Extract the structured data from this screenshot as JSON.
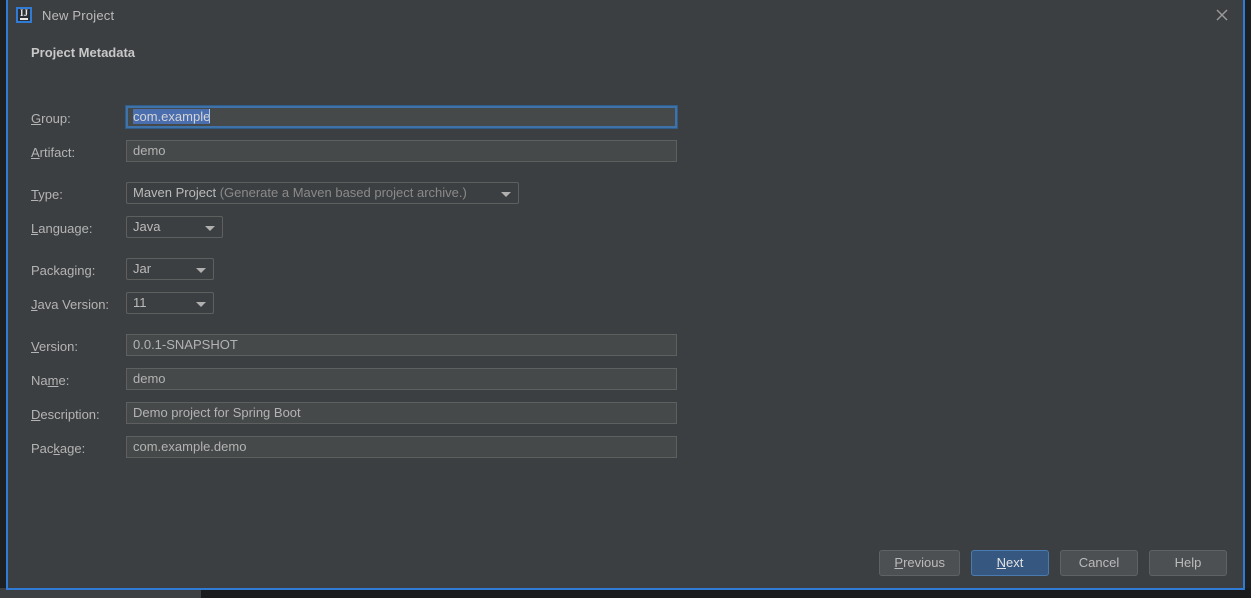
{
  "window": {
    "title": "New Project",
    "app_icon": "intellij-idea-icon",
    "icon_text": "IJ",
    "close_icon": "close-icon",
    "accent_color": "#2f7bd6",
    "background_color": "#3c3f41"
  },
  "section": {
    "title": "Project Metadata"
  },
  "fields": {
    "group": {
      "label_pre": "",
      "label_mnemonic": "G",
      "label_post": "roup:",
      "value": "com.example",
      "selected": true,
      "focused": true
    },
    "artifact": {
      "label_pre": "",
      "label_mnemonic": "A",
      "label_post": "rtifact:",
      "value": "demo"
    },
    "type": {
      "label_pre": "",
      "label_mnemonic": "T",
      "label_post": "ype:",
      "value": "Maven Project",
      "value_hint": "(Generate a Maven based project archive.)"
    },
    "language": {
      "label_pre": "",
      "label_mnemonic": "L",
      "label_post": "anguage:",
      "value": "Java"
    },
    "packaging": {
      "label_pre": "Packa",
      "label_mnemonic": "g",
      "label_post": "ing:",
      "value": "Jar"
    },
    "java_version": {
      "label_pre": "",
      "label_mnemonic": "J",
      "label_post": "ava Version:",
      "value": "11"
    },
    "version": {
      "label_pre": "",
      "label_mnemonic": "V",
      "label_post": "ersion:",
      "value": "0.0.1-SNAPSHOT"
    },
    "name": {
      "label_pre": "Na",
      "label_mnemonic": "m",
      "label_post": "e:",
      "value": "demo"
    },
    "description": {
      "label_pre": "",
      "label_mnemonic": "D",
      "label_post": "escription:",
      "value": "Demo project for Spring Boot"
    },
    "package": {
      "label_pre": "Pac",
      "label_mnemonic": "k",
      "label_post": "age:",
      "value": "com.example.demo"
    }
  },
  "buttons": {
    "previous": {
      "pre": "",
      "mnemonic": "P",
      "post": "revious"
    },
    "next": {
      "pre": "",
      "mnemonic": "N",
      "post": "ext",
      "primary": true
    },
    "cancel": {
      "pre": "Cancel",
      "mnemonic": "",
      "post": ""
    },
    "help": {
      "pre": "Help",
      "mnemonic": "",
      "post": ""
    }
  }
}
